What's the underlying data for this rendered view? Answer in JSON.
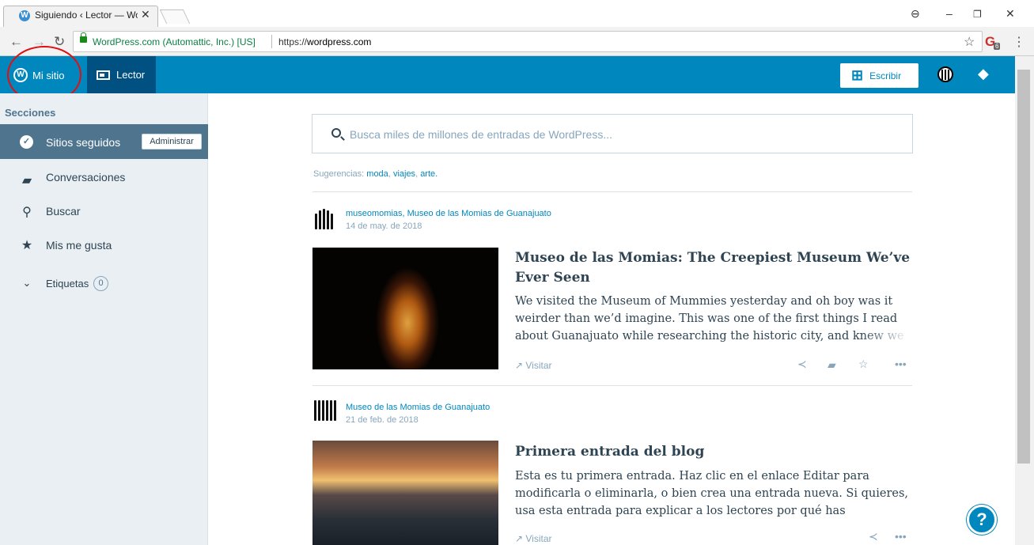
{
  "browser": {
    "tab_title": "Siguiendo ‹ Lector — Wo",
    "secure_text": "WordPress.com (Automattic, Inc.) [US]",
    "url_prefix": "https://",
    "url_host": "wordpress.com",
    "extension_badge": "6"
  },
  "masterbar": {
    "my_site": "Mi sitio",
    "reader": "Lector",
    "write": "Escribir"
  },
  "sidebar": {
    "section_title": "Secciones",
    "items": [
      {
        "label": "Sitios seguidos",
        "icon": "check-circle-icon",
        "active": true
      },
      {
        "label": "Conversaciones",
        "icon": "comments-icon"
      },
      {
        "label": "Buscar",
        "icon": "search-icon"
      },
      {
        "label": "Mis me gusta",
        "icon": "star-icon"
      },
      {
        "label": "Etiquetas",
        "icon": "chevron-down-icon",
        "count": "0"
      }
    ],
    "manage_button": "Administrar"
  },
  "search": {
    "placeholder": "Busca miles de millones de entradas de WordPress..."
  },
  "suggestions": {
    "label": "Sugerencias:",
    "items": [
      "moda",
      "viajes",
      "arte."
    ]
  },
  "posts": [
    {
      "site": "museomomias, Museo de las Momias de Guanajuato",
      "date": "14 de may. de 2018",
      "title": "Museo de las Momias: The Creepiest Museum We’ve Ever Seen",
      "excerpt": "We visited the Museum of Mummies yesterday and oh boy was it weirder than we’d imagine. This was one of the first things I read about Guanajuato while researching the historic city, and knew we",
      "visit": "Visitar"
    },
    {
      "site": "Museo de las Momias de Guanajuato",
      "date": "21 de feb. de 2018",
      "title": "Primera entrada del blog",
      "excerpt": "Esta es tu primera entrada. Haz clic en el enlace Editar para modificarla o eliminarla, o bien crea una entrada nueva. Si quieres, usa esta entrada para explicar a los lectores por qué has",
      "visit": "Visitar"
    }
  ],
  "colors": {
    "masterbar": "#0087be",
    "reader_active": "#005082",
    "sidebar_bg": "#e9eff3",
    "sidebar_active": "#4f748e",
    "annotation_circle": "#e01010"
  }
}
